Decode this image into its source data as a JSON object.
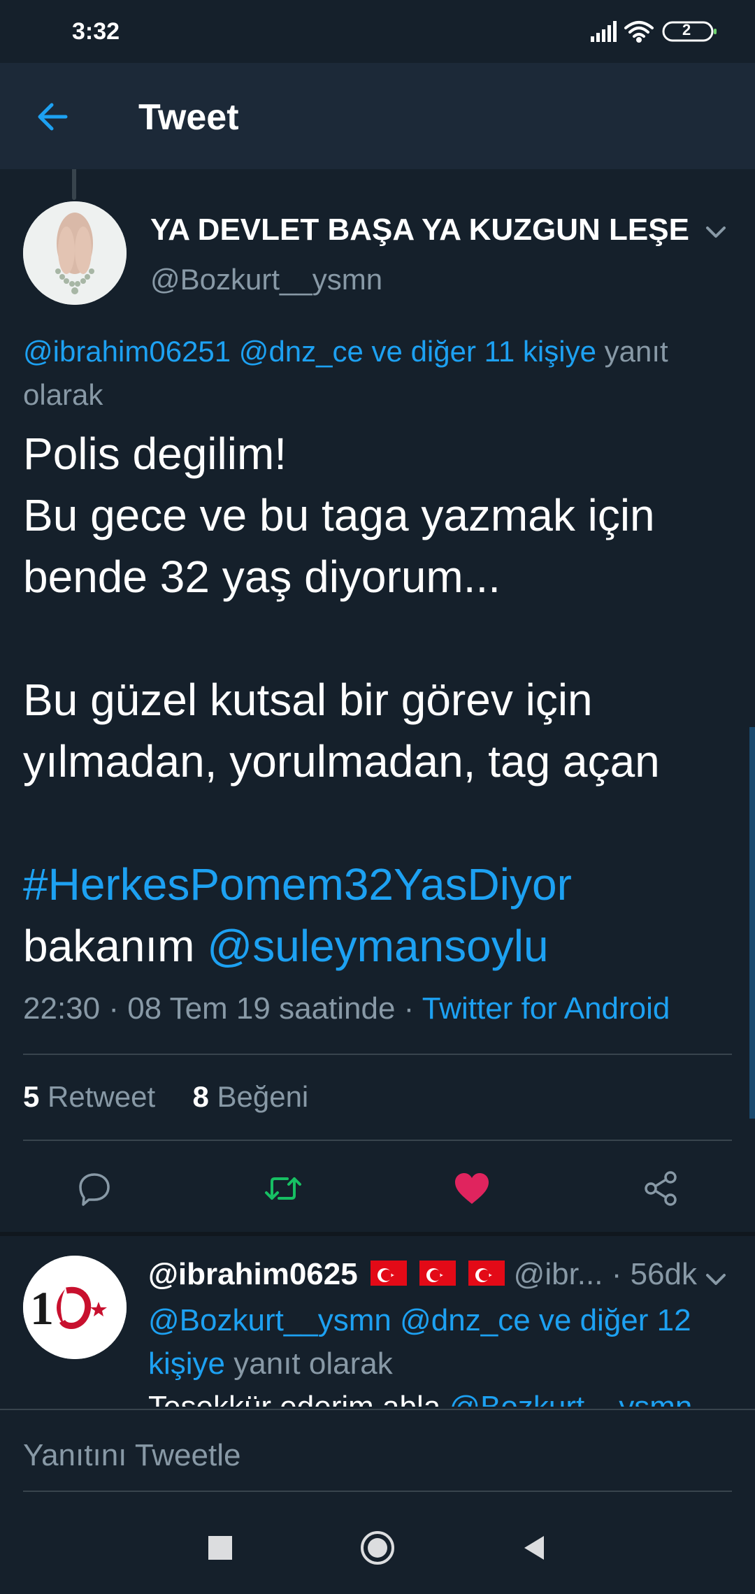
{
  "status_bar": {
    "time": "3:32",
    "battery_level": "2"
  },
  "app_bar": {
    "title": "Tweet",
    "back_icon": "arrow-left-icon"
  },
  "tweet": {
    "display_name": "YA DEVLET BAŞA YA KUZGUN LEŞE",
    "username": "@Bozkurt__ysmn",
    "reply_to": {
      "mentions": "@ibrahim06251 @dnz_ce ve diğer 11 kişiye",
      "suffix": "yanıt olarak"
    },
    "body": {
      "line1": "Polis degilim!",
      "line2": "Bu gece ve bu taga yazmak için",
      "line3": "bende 32 yaş diyorum...",
      "line5": "Bu güzel kutsal bir görev için",
      "line6": "yılmadan, yorulmadan, tag açan",
      "hashtag": "#HerkesPomem32YasDiyor",
      "line9_prefix": "bakanım",
      "mention": "@suleymansoylu"
    },
    "timestamp": "22:30 · 08 Tem 19 saatinde · ",
    "source": "Twitter for Android",
    "retweet_count": "5",
    "retweet_label": "Retweet",
    "like_count": "8",
    "like_label": "Beğeni",
    "liked": true,
    "retweet_color": "#17bf63",
    "like_color": "#e0245e"
  },
  "reply": {
    "name": "@ibrahim0625",
    "handle": "@ibr...",
    "time": "· 56dk",
    "reply_to_mentions": "@Bozkurt__ysmn @dnz_ce ve diğer 12 kişiye",
    "reply_to_suffix": "yanıt olarak",
    "preview_text": "Teşekkür ederim abla ",
    "preview_mention": "@Bozkurt__ysmn"
  },
  "composer": {
    "placeholder": "Yanıtını Tweetle"
  },
  "colors": {
    "background": "#15202b",
    "appbar": "#1c2938",
    "accent": "#1da1f2",
    "secondary_text": "#8899a6"
  }
}
